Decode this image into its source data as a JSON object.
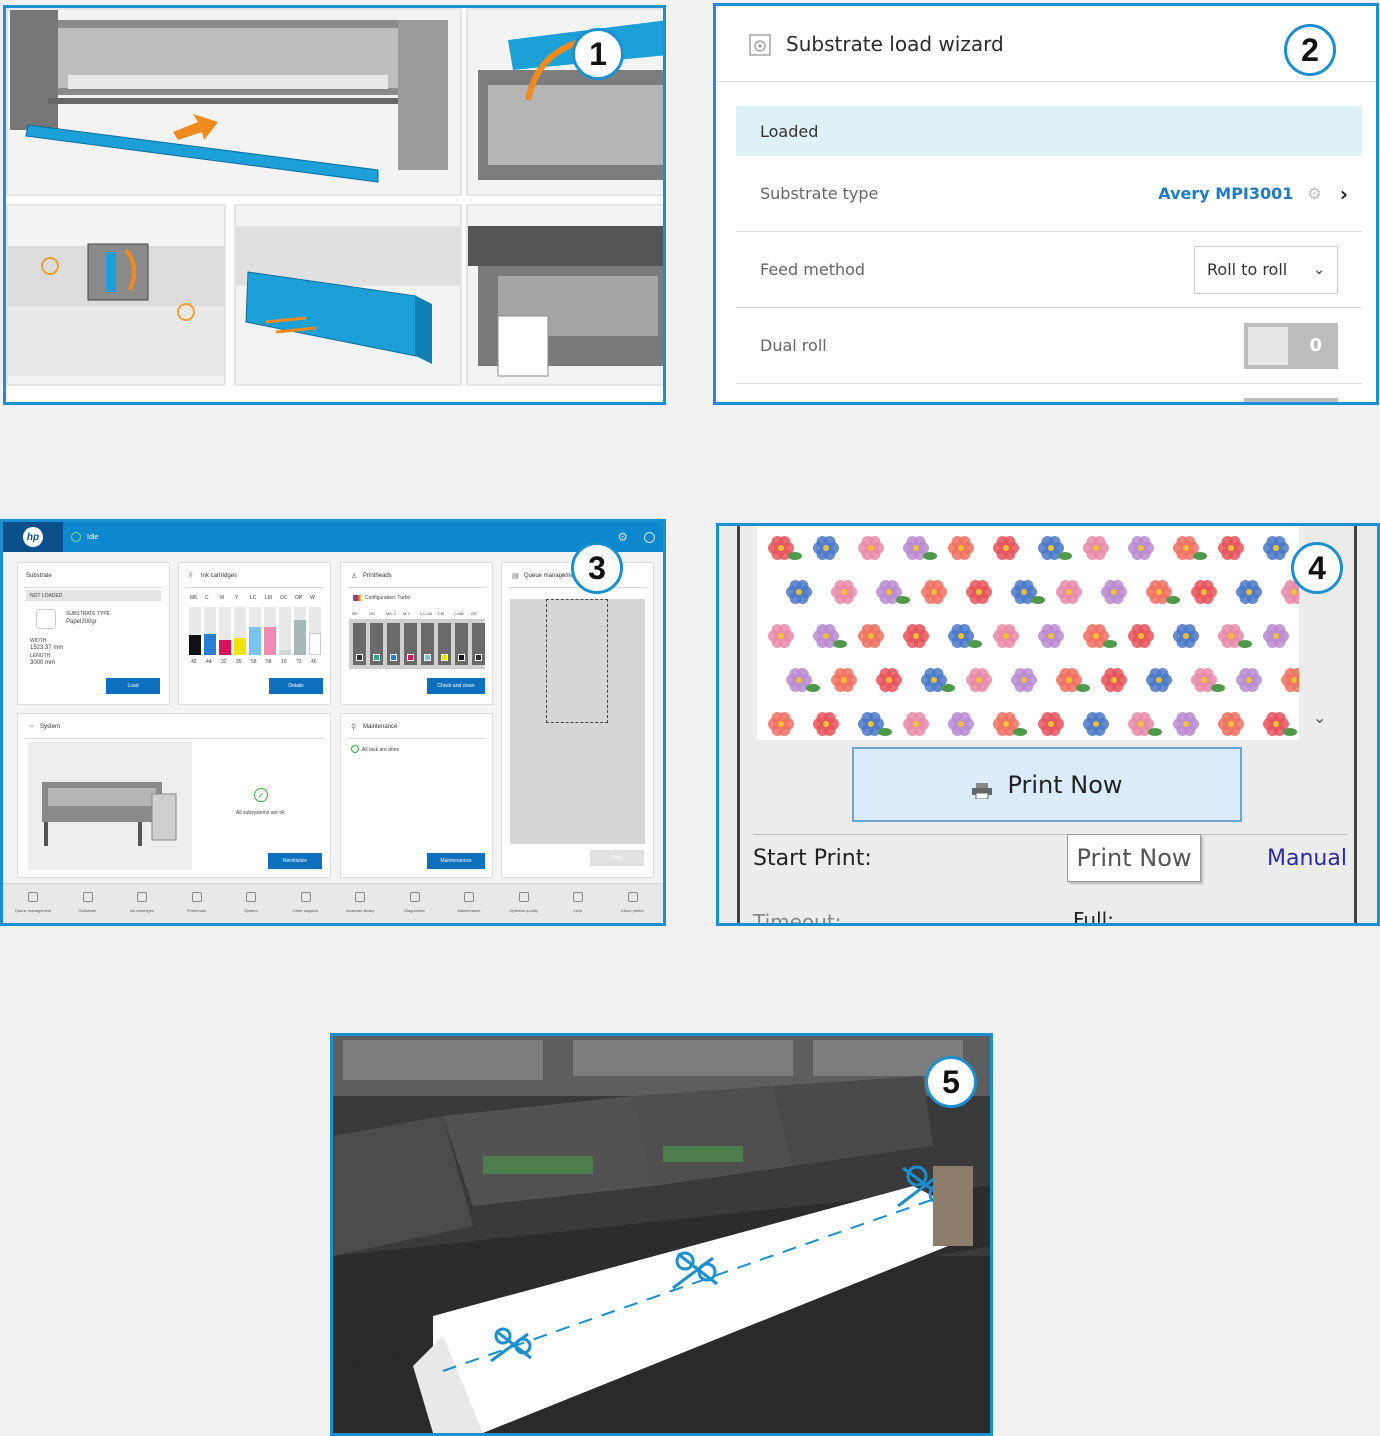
{
  "badges": [
    "1",
    "2",
    "3",
    "4",
    "5"
  ],
  "wizard": {
    "title": "Substrate load wizard",
    "status": "Loaded",
    "rows": {
      "substrate_type": {
        "label": "Substrate type",
        "value": "Avery MPI3001"
      },
      "feed_method": {
        "label": "Feed method",
        "value": "Roll to roll"
      },
      "dual_roll": {
        "label": "Dual roll",
        "value": "0"
      }
    },
    "colors": {
      "accent": "#1a8fd1",
      "link": "#1f7bc4",
      "status_bg": "#dff1f7"
    }
  },
  "dashboard": {
    "status": "Idle",
    "substrate": {
      "title": "Substrate",
      "state": "NOT LOADED",
      "type_label": "SUBSTRATE TYPE",
      "type_value": "Papel200gr",
      "width_label": "WIDTH",
      "width_value": "1523.37 mm",
      "length_label": "LENGTH",
      "length_value": "3000 mm",
      "button": "Load"
    },
    "ink": {
      "title": "Ink cartridges",
      "channels": [
        "MK",
        "C",
        "M",
        "Y",
        "LC",
        "LM",
        "OC",
        "OP",
        "W"
      ],
      "levels": [
        "42",
        "44",
        "32",
        "35",
        "58",
        "58",
        "10",
        "73",
        "46"
      ],
      "colors": [
        "#111111",
        "#2a7fd4",
        "#d4145a",
        "#f2e200",
        "#7cc4ef",
        "#f08ab0",
        "#cfd8d8",
        "#a6b8b8",
        "#ffffff"
      ],
      "button": "Details"
    },
    "printheads": {
      "title": "Printheads",
      "config": "Configuration: Turbo",
      "slots": [
        "OP",
        "OC",
        "MK-C",
        "M-Y",
        "LC-LM",
        "Y-M",
        "C-MK",
        "OP"
      ],
      "button": "Check and clean"
    },
    "queue": {
      "title": "Queue management",
      "button": "Print"
    },
    "system": {
      "title": "System",
      "message": "All subsystems are ok",
      "button": "Reinitialize"
    },
    "maintenance": {
      "title": "Maintenance",
      "message": "All task are done",
      "button": "Maintenances"
    },
    "nav": [
      "Queue management",
      "Substrate",
      "Ink cartridges",
      "Printheads",
      "System",
      "Other supplies",
      "Substrate library",
      "Diagnostics",
      "Maintenance",
      "Optimize quality",
      "Help",
      "About printer"
    ]
  },
  "rip": {
    "print_button": "Print Now",
    "start_print_label": "Start Print:",
    "start_print_value": "Print Now",
    "start_print_mode": "Manual",
    "timeout_label": "Timeout:",
    "timeout_value": "Full:"
  }
}
